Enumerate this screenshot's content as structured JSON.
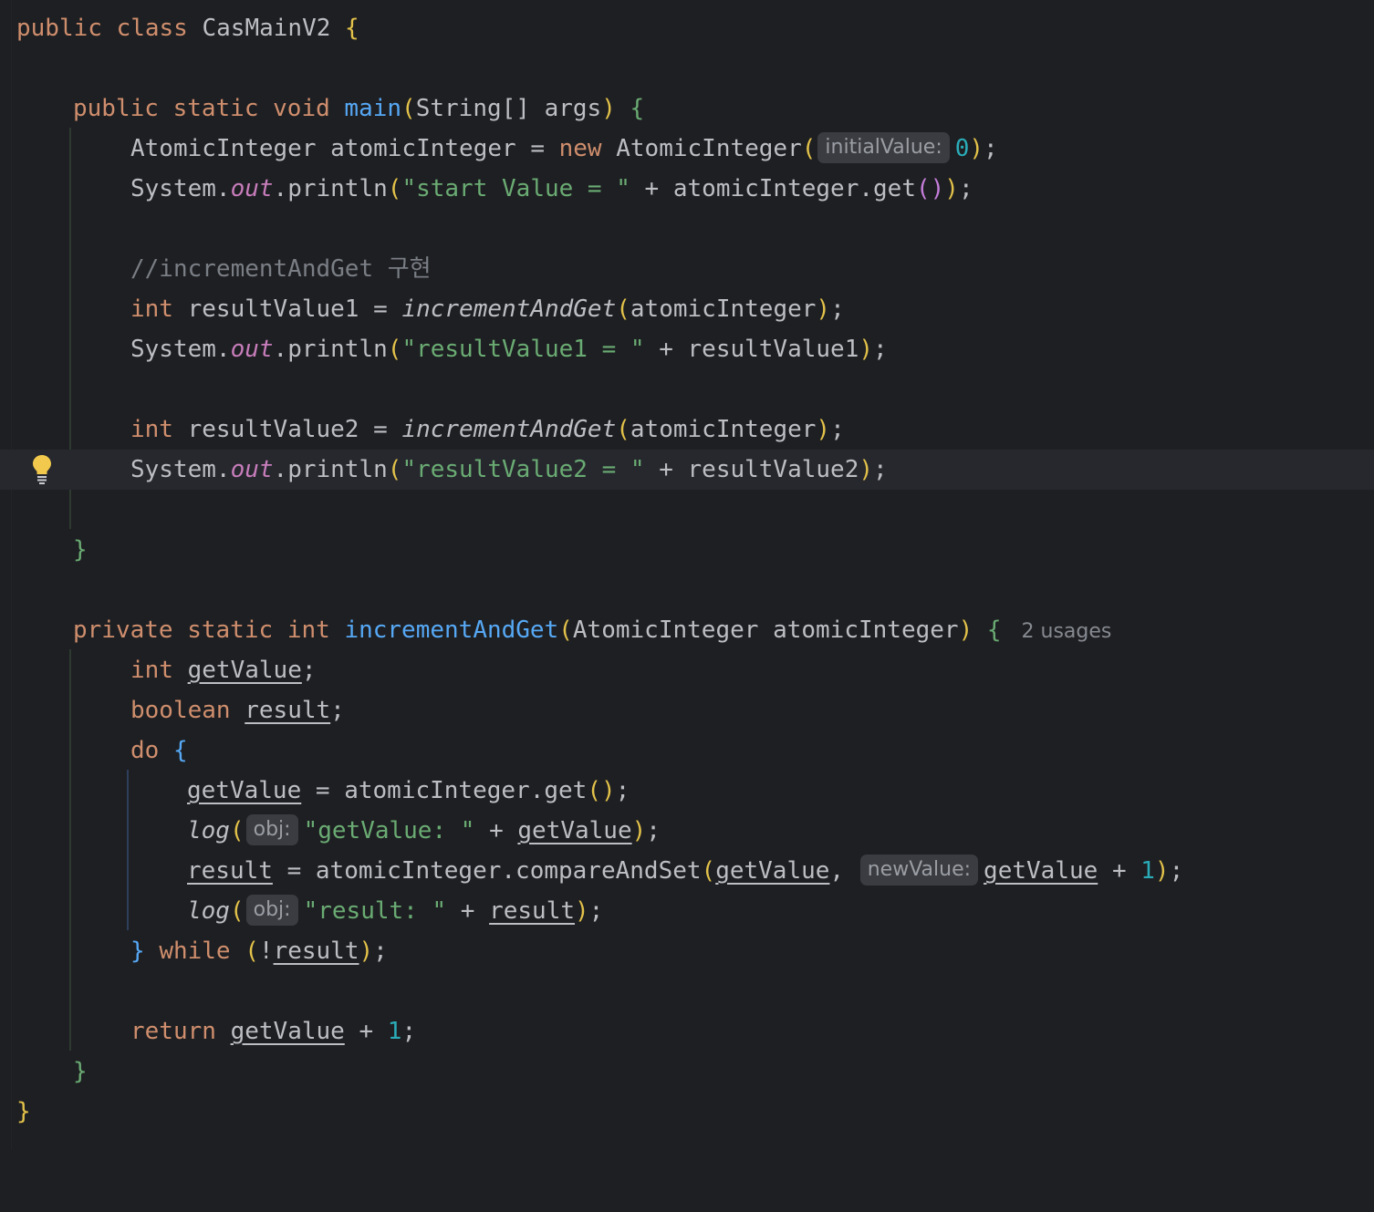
{
  "code": {
    "class_decl": {
      "kw": "public class",
      "name": "CasMainV2"
    },
    "main_decl": {
      "kw": "public static void",
      "name": "main",
      "params_type": "String[]",
      "params_name": "args"
    },
    "l1": {
      "type": "AtomicInteger",
      "var": "atomicInteger",
      "eq": "=",
      "new_kw": "new",
      "ctor": "AtomicInteger",
      "hint": "initialValue:",
      "arg": "0"
    },
    "l2": {
      "sys": "System.",
      "out": "out",
      "println": ".println",
      "str": "\"start Value = \"",
      "plus": "+",
      "rest": "atomicInteger.get"
    },
    "comment": "//incrementAndGet 구현",
    "l3": {
      "kw": "int",
      "var": "resultValue1",
      "eq": "=",
      "call": "incrementAndGet",
      "arg": "atomicInteger"
    },
    "l4": {
      "sys": "System.",
      "out": "out",
      "println": ".println",
      "str": "\"resultValue1 = \"",
      "plus": "+",
      "arg": "resultValue1"
    },
    "l5": {
      "kw": "int",
      "var": "resultValue2",
      "eq": "=",
      "call": "incrementAndGet",
      "arg": "atomicInteger"
    },
    "l6": {
      "sys": "System.",
      "out": "out",
      "println": ".println",
      "str": "\"resultValue2 = \"",
      "plus": "+",
      "arg": "resultValue2"
    },
    "method_decl": {
      "kw1": "private static",
      "kw2": "int",
      "name": "incrementAndGet",
      "ptype": "AtomicInteger",
      "pname": "atomicInteger",
      "usages": "2 usages"
    },
    "m1": {
      "kw": "int",
      "var": "getValue"
    },
    "m2": {
      "kw": "boolean",
      "var": "result"
    },
    "m3": {
      "kw": "do"
    },
    "m4": {
      "var": "getValue",
      "eq": "=",
      "call": "atomicInteger.get"
    },
    "m5": {
      "call": "log",
      "hint": "obj:",
      "str": "\"getValue: \"",
      "plus": "+",
      "var": "getValue"
    },
    "m6": {
      "var": "result",
      "eq": "=",
      "call": "atomicInteger.compareAndSet",
      "arg1": "getValue",
      "hint": "newValue:",
      "arg2": "getValue",
      "plus": "+",
      "num": "1"
    },
    "m7": {
      "call": "log",
      "hint": "obj:",
      "str": "\"result: \"",
      "plus": "+",
      "var": "result"
    },
    "m8": {
      "kw": "while",
      "not": "!",
      "var": "result"
    },
    "m9": {
      "kw": "return",
      "var": "getValue",
      "plus": "+",
      "num": "1"
    }
  },
  "colors": {
    "background": "#1e1f22",
    "current_line": "#26282e",
    "keyword": "#cf8e6d",
    "function": "#56a8f5",
    "string": "#6aab73",
    "number": "#2aacb8",
    "comment": "#7a7e85",
    "static_field": "#c77dbb",
    "bulb": "#f2c94c"
  },
  "icons": {
    "intention": "lightbulb-icon"
  }
}
